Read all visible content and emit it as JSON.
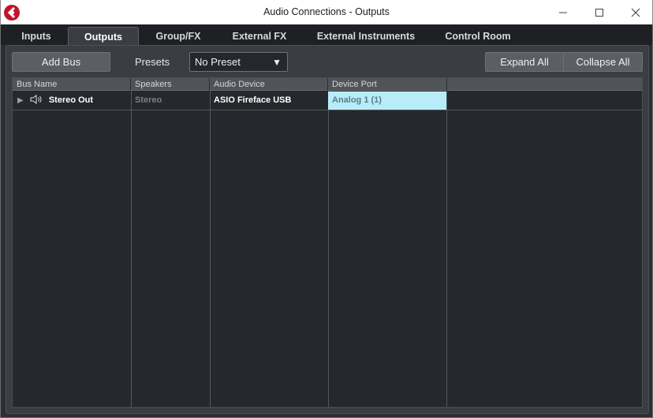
{
  "window": {
    "title": "Audio Connections - Outputs"
  },
  "tabs": [
    {
      "label": "Inputs",
      "active": false
    },
    {
      "label": "Outputs",
      "active": true
    },
    {
      "label": "Group/FX",
      "active": false
    },
    {
      "label": "External FX",
      "active": false
    },
    {
      "label": "External Instruments",
      "active": false
    },
    {
      "label": "Control Room",
      "active": false
    }
  ],
  "toolbar": {
    "add_bus_label": "Add Bus",
    "presets_label": "Presets",
    "preset_value": "No Preset",
    "expand_all_label": "Expand All",
    "collapse_all_label": "Collapse All"
  },
  "table": {
    "columns": [
      "Bus Name",
      "Speakers",
      "Audio Device",
      "Device Port",
      ""
    ],
    "rows": [
      {
        "bus_name": "Stereo Out",
        "speakers": "Stereo",
        "audio_device": "ASIO Fireface USB",
        "device_port": "Analog 1 (1)"
      }
    ]
  },
  "icons": {
    "app": "cubase-logo-icon",
    "minimize": "minimize-icon",
    "maximize": "maximize-icon",
    "close": "close-icon",
    "expand": "triangle-right-icon",
    "bus": "speaker-icon",
    "dropdown": "triangle-down-icon"
  },
  "colors": {
    "brand": "#c0142c",
    "background": "#2b2e32",
    "selected_port": "#b8ecf8"
  }
}
